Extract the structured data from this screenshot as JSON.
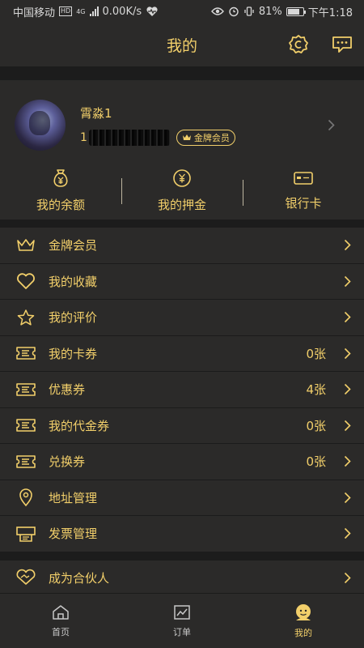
{
  "status_bar": {
    "carrier": "中国移动",
    "hd": "HD",
    "net": "4G",
    "speed": "0.00K/s",
    "battery": "81%",
    "time": "下午1:18"
  },
  "nav": {
    "title": "我的"
  },
  "profile": {
    "name": "霄淼1",
    "phone_prefix": "1",
    "badge": "金牌会员"
  },
  "stats": [
    {
      "label": "我的余额",
      "icon": "money-bag-icon"
    },
    {
      "label": "我的押金",
      "icon": "yen-coin-icon"
    },
    {
      "label": "银行卡",
      "icon": "bank-card-icon"
    }
  ],
  "menu": [
    {
      "label": "金牌会员",
      "value": "",
      "icon": "crown-icon"
    },
    {
      "label": "我的收藏",
      "value": "",
      "icon": "heart-icon"
    },
    {
      "label": "我的评价",
      "value": "",
      "icon": "star-icon"
    },
    {
      "label": "我的卡券",
      "value": "0张",
      "icon": "ticket-icon"
    },
    {
      "label": "优惠券",
      "value": "4张",
      "icon": "ticket-icon"
    },
    {
      "label": "我的代金券",
      "value": "0张",
      "icon": "ticket-icon"
    },
    {
      "label": "兑换券",
      "value": "0张",
      "icon": "ticket-icon"
    },
    {
      "label": "地址管理",
      "value": "",
      "icon": "location-pin-icon"
    },
    {
      "label": "发票管理",
      "value": "",
      "icon": "invoice-icon"
    }
  ],
  "partner": {
    "label": "成为合伙人",
    "icon": "handshake-icon"
  },
  "tabs": [
    {
      "label": "首页",
      "icon": "home-icon"
    },
    {
      "label": "订单",
      "icon": "orders-chart-icon"
    },
    {
      "label": "我的",
      "icon": "profile-icon"
    }
  ],
  "colors": {
    "accent": "#f2cf6a",
    "panel": "#2b2a29",
    "background": "#1c1c1c"
  }
}
